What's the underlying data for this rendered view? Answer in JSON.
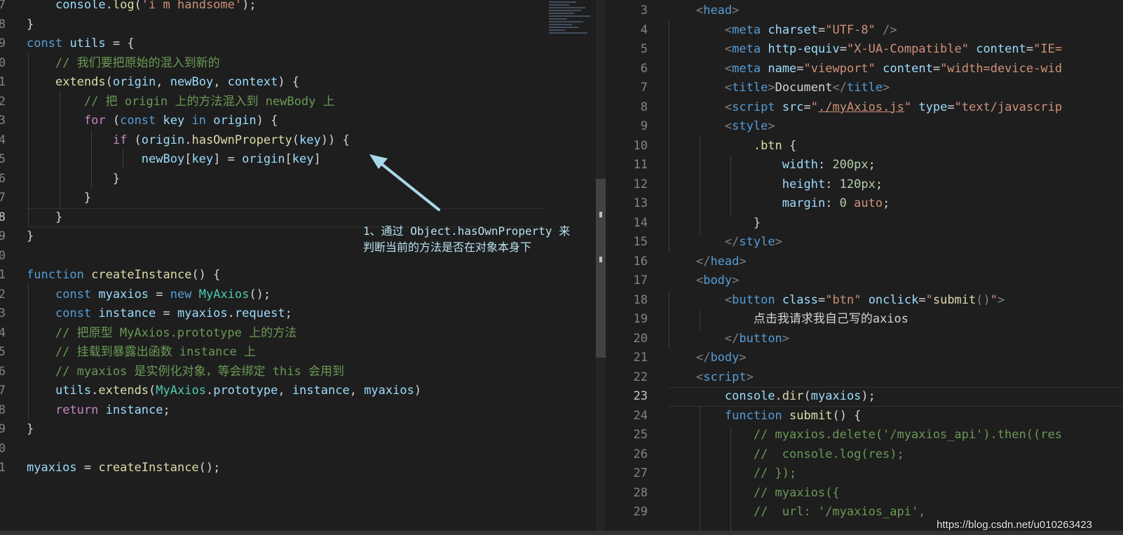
{
  "left_editor": {
    "lines": [
      {
        "n": "7",
        "html": "    <span class='var'>console</span>.<span class='fn'>log</span>(<span class='str'>'i m handsome'</span>);"
      },
      {
        "n": "8",
        "html": "}"
      },
      {
        "n": "9",
        "html": "<span class='kw'>const</span> <span class='var'>utils</span> = {"
      },
      {
        "n": "0",
        "html": "    <span class='cmt'>// 我们要把原始的混入到新的</span>"
      },
      {
        "n": "1",
        "html": "    <span class='fn'>extends</span>(<span class='var'>origin</span>, <span class='var'>newBoy</span>, <span class='var'>context</span>) {"
      },
      {
        "n": "2",
        "html": "        <span class='cmt'>// 把 origin 上的方法混入到 newBody 上</span>"
      },
      {
        "n": "3",
        "html": "        <span class='ctrl'>for</span> (<span class='kw'>const</span> <span class='var'>key</span> <span class='kw'>in</span> <span class='var'>origin</span>) {"
      },
      {
        "n": "4",
        "html": "            <span class='ctrl'>if</span> (<span class='var'>origin</span>.<span class='fn'>hasOwnProperty</span>(<span class='var'>key</span>)) {"
      },
      {
        "n": "5",
        "html": "                <span class='var'>newBoy</span>[<span class='var'>key</span>] = <span class='var'>origin</span>[<span class='var'>key</span>]"
      },
      {
        "n": "6",
        "html": "            }"
      },
      {
        "n": "7",
        "html": "        }"
      },
      {
        "n": "8",
        "html": "    }",
        "active": true
      },
      {
        "n": "9",
        "html": "}"
      },
      {
        "n": "0",
        "html": ""
      },
      {
        "n": "1",
        "html": "<span class='kw'>function</span> <span class='fn'>createInstance</span>() {"
      },
      {
        "n": "2",
        "html": "    <span class='kw'>const</span> <span class='var'>myaxios</span> = <span class='kw'>new</span> <span class='cls'>MyAxios</span>();"
      },
      {
        "n": "3",
        "html": "    <span class='kw'>const</span> <span class='var'>instance</span> = <span class='var'>myaxios</span>.<span class='var'>request</span>;"
      },
      {
        "n": "4",
        "html": "    <span class='cmt'>// 把原型 MyAxios.prototype 上的方法</span>"
      },
      {
        "n": "5",
        "html": "    <span class='cmt'>// 挂载到暴露出函数 instance 上</span>"
      },
      {
        "n": "6",
        "html": "    <span class='cmt'>// myaxios 是实例化对象，等会绑定 this 会用到</span>"
      },
      {
        "n": "7",
        "html": "    <span class='var'>utils</span>.<span class='fn'>extends</span>(<span class='cls'>MyAxios</span>.<span class='var'>prototype</span>, <span class='var'>instance</span>, <span class='var'>myaxios</span>)"
      },
      {
        "n": "8",
        "html": "    <span class='ctrl'>return</span> <span class='var'>instance</span>;"
      },
      {
        "n": "9",
        "html": "}"
      },
      {
        "n": "0",
        "html": ""
      },
      {
        "n": "1",
        "html": "<span class='var'>myaxios</span> = <span class='fn'>createInstance</span>();"
      }
    ]
  },
  "annotation": {
    "line1": "1、通过 Object.hasOwnProperty 来",
    "line2": "判断当前的方法是否在对象本身下"
  },
  "right_editor": {
    "lines": [
      {
        "n": "3",
        "html": "    <span class='punct'>&lt;</span><span class='tag'>head</span><span class='punct'>&gt;</span>"
      },
      {
        "n": "4",
        "html": "        <span class='punct'>&lt;</span><span class='tag'>meta</span> <span class='attr'>charset</span>=<span class='str'>\"UTF-8\"</span> <span class='punct'>/&gt;</span>"
      },
      {
        "n": "5",
        "html": "        <span class='punct'>&lt;</span><span class='tag'>meta</span> <span class='attr'>http-equiv</span>=<span class='str'>\"X-UA-Compatible\"</span> <span class='attr'>content</span>=<span class='str'>\"IE=</span>"
      },
      {
        "n": "6",
        "html": "        <span class='punct'>&lt;</span><span class='tag'>meta</span> <span class='attr'>name</span>=<span class='str'>\"viewport\"</span> <span class='attr'>content</span>=<span class='str'>\"width=device-wid</span>"
      },
      {
        "n": "7",
        "html": "        <span class='punct'>&lt;</span><span class='tag'>title</span><span class='punct'>&gt;</span><span class='txt'>Document</span><span class='punct'>&lt;/</span><span class='tag'>title</span><span class='punct'>&gt;</span>"
      },
      {
        "n": "8",
        "html": "        <span class='punct'>&lt;</span><span class='tag'>script</span> <span class='attr'>src</span>=<span class='str'>\"</span><span class='link'>./myAxios.js</span><span class='str'>\"</span> <span class='attr'>type</span>=<span class='str'>\"text/javascrip</span>"
      },
      {
        "n": "9",
        "html": "        <span class='punct'>&lt;</span><span class='tag'>style</span><span class='punct'>&gt;</span>"
      },
      {
        "n": "10",
        "html": "            <span class='fn'>.btn</span> {"
      },
      {
        "n": "11",
        "html": "                <span class='attr'>width</span>: <span class='num'>200px</span>;"
      },
      {
        "n": "12",
        "html": "                <span class='attr'>height</span>: <span class='num'>120px</span>;"
      },
      {
        "n": "13",
        "html": "                <span class='attr'>margin</span>: <span class='num'>0</span> <span class='str'>auto</span>;"
      },
      {
        "n": "14",
        "html": "            }"
      },
      {
        "n": "15",
        "html": "        <span class='punct'>&lt;/</span><span class='tag'>style</span><span class='punct'>&gt;</span>"
      },
      {
        "n": "16",
        "html": "    <span class='punct'>&lt;/</span><span class='tag'>head</span><span class='punct'>&gt;</span>"
      },
      {
        "n": "17",
        "html": "    <span class='punct'>&lt;</span><span class='tag'>body</span><span class='punct'>&gt;</span>"
      },
      {
        "n": "18",
        "html": "        <span class='punct'>&lt;</span><span class='tag'>button</span> <span class='attr'>class</span>=<span class='str'>\"btn\"</span> <span class='attr'>onclick</span>=<span class='str'>\"</span><span class='fn'>submit</span><span class='punct'>()</span><span class='str'>\"</span><span class='punct'>&gt;</span>"
      },
      {
        "n": "19",
        "html": "            <span class='txt'>点击我请求我自己写的axios</span>"
      },
      {
        "n": "20",
        "html": "        <span class='punct'>&lt;/</span><span class='tag'>button</span><span class='punct'>&gt;</span>"
      },
      {
        "n": "21",
        "html": "    <span class='punct'>&lt;/</span><span class='tag'>body</span><span class='punct'>&gt;</span>"
      },
      {
        "n": "22",
        "html": "    <span class='punct'>&lt;</span><span class='tag'>script</span><span class='punct'>&gt;</span>"
      },
      {
        "n": "23",
        "html": "        <span class='var'>console</span>.<span class='fn'>dir</span>(<span class='var'>myaxios</span>);",
        "active": true
      },
      {
        "n": "24",
        "html": "        <span class='kw'>function</span> <span class='fn'>submit</span>() {"
      },
      {
        "n": "25",
        "html": "            <span class='cmt'>// myaxios.delete('/myaxios_api').then((res</span>"
      },
      {
        "n": "26",
        "html": "            <span class='cmt'>//  console.log(res);</span>"
      },
      {
        "n": "27",
        "html": "            <span class='cmt'>// });</span>"
      },
      {
        "n": "28",
        "html": "            <span class='cmt'>// myaxios({</span>"
      },
      {
        "n": "29",
        "html": "            <span class='cmt'>//  url: '/myaxios_api',</span>"
      }
    ]
  },
  "watermark": "https://blog.csdn.net/u010263423"
}
